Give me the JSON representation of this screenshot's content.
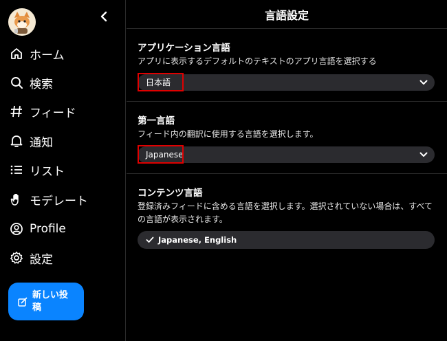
{
  "sidebar": {
    "nav": [
      {
        "label": "ホーム",
        "icon": "home-icon"
      },
      {
        "label": "検索",
        "icon": "search-icon"
      },
      {
        "label": "フィード",
        "icon": "hash-icon"
      },
      {
        "label": "通知",
        "icon": "bell-icon"
      },
      {
        "label": "リスト",
        "icon": "list-icon"
      },
      {
        "label": "モデレート",
        "icon": "hand-icon"
      },
      {
        "label": "Profile",
        "icon": "profile-icon"
      },
      {
        "label": "設定",
        "icon": "gear-icon"
      }
    ],
    "new_post_label": "新しい投稿"
  },
  "header": {
    "title": "言語設定"
  },
  "sections": {
    "app_language": {
      "title": "アプリケーション言語",
      "description": "アプリに表示するデフォルトのテキストのアプリ言語を選択する",
      "value": "日本語"
    },
    "primary_language": {
      "title": "第一言語",
      "description": "フィード内の翻訳に使用する言語を選択します。",
      "value": "Japanese"
    },
    "content_languages": {
      "title": "コンテンツ言語",
      "description": "登録済みフィードに含める言語を選択します。選択されていない場合は、すべての言語が表示されます。",
      "value": "Japanese, English"
    }
  },
  "colors": {
    "background": "#000000",
    "accent": "#0a84ff",
    "select_bg": "#2b2b2f",
    "highlight": "#e00000"
  }
}
